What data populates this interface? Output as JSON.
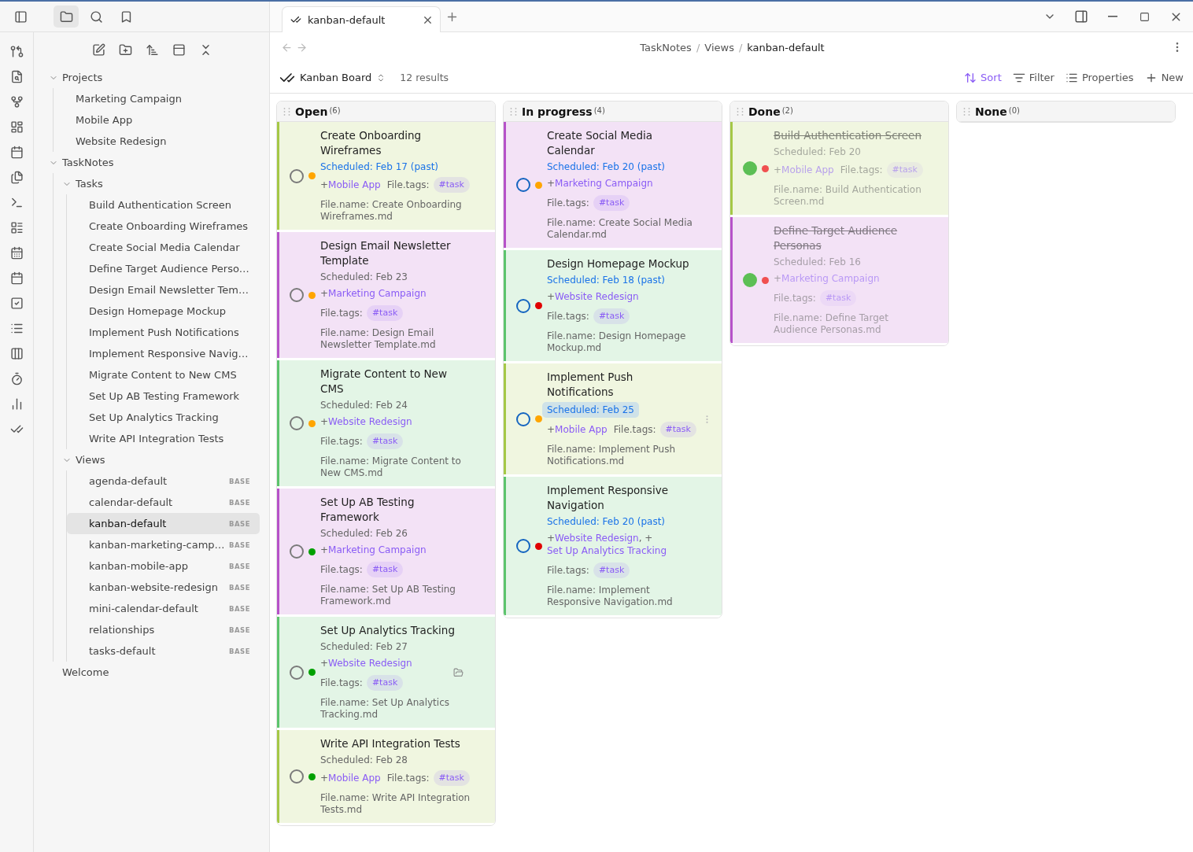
{
  "sidebar_tabs": [
    {
      "kind": "files",
      "selected": true
    },
    {
      "kind": "search",
      "selected": false
    },
    {
      "kind": "bookmarks",
      "selected": false
    }
  ],
  "file_tree": [
    {
      "label": "Projects",
      "kind": "folder",
      "expanded": true,
      "selected": false,
      "children": [
        {
          "label": "Marketing Campaign",
          "kind": "file",
          "selected": false
        },
        {
          "label": "Mobile App",
          "kind": "file",
          "selected": false
        },
        {
          "label": "Website Redesign",
          "kind": "file",
          "selected": false
        }
      ]
    },
    {
      "label": "TaskNotes",
      "kind": "folder",
      "expanded": true,
      "selected": false,
      "children": [
        {
          "label": "Tasks",
          "kind": "folder",
          "expanded": true,
          "selected": false,
          "children": [
            {
              "label": "Build Authentication Screen",
              "kind": "file",
              "selected": false
            },
            {
              "label": "Create Onboarding Wireframes",
              "kind": "file",
              "selected": false
            },
            {
              "label": "Create Social Media Calendar",
              "kind": "file",
              "selected": false
            },
            {
              "label": "Define Target Audience Perso…",
              "kind": "file",
              "selected": false
            },
            {
              "label": "Design Email Newsletter Tem…",
              "kind": "file",
              "selected": false
            },
            {
              "label": "Design Homepage Mockup",
              "kind": "file",
              "selected": false
            },
            {
              "label": "Implement Push Notifications",
              "kind": "file",
              "selected": false
            },
            {
              "label": "Implement Responsive Navig…",
              "kind": "file",
              "selected": false
            },
            {
              "label": "Migrate Content to New CMS",
              "kind": "file",
              "selected": false
            },
            {
              "label": "Set Up AB Testing Framework",
              "kind": "file",
              "selected": false
            },
            {
              "label": "Set Up Analytics Tracking",
              "kind": "file",
              "selected": false
            },
            {
              "label": "Write API Integration Tests",
              "kind": "file",
              "selected": false
            }
          ]
        },
        {
          "label": "Views",
          "kind": "folder",
          "expanded": true,
          "selected": false,
          "children": [
            {
              "label": "agenda-default",
              "kind": "file",
              "badge": "BASE",
              "selected": false
            },
            {
              "label": "calendar-default",
              "kind": "file",
              "badge": "BASE",
              "selected": false
            },
            {
              "label": "kanban-default",
              "kind": "file",
              "badge": "BASE",
              "selected": true
            },
            {
              "label": "kanban-marketing-camp…",
              "kind": "file",
              "badge": "BASE",
              "selected": false
            },
            {
              "label": "kanban-mobile-app",
              "kind": "file",
              "badge": "BASE",
              "selected": false
            },
            {
              "label": "kanban-website-redesign",
              "kind": "file",
              "badge": "BASE",
              "selected": false
            },
            {
              "label": "mini-calendar-default",
              "kind": "file",
              "badge": "BASE",
              "selected": false
            },
            {
              "label": "relationships",
              "kind": "file",
              "badge": "BASE",
              "selected": false
            },
            {
              "label": "tasks-default",
              "kind": "file",
              "badge": "BASE",
              "selected": false
            }
          ]
        }
      ]
    },
    {
      "label": "Welcome",
      "kind": "file",
      "selected": false
    }
  ],
  "tab": {
    "title": "kanban-default"
  },
  "breadcrumb": {
    "separator": "/",
    "parts": [
      "TaskNotes",
      "Views",
      "kanban-default"
    ]
  },
  "toolbar": {
    "view_name": "Kanban Board",
    "results": "12 results",
    "actions": [
      {
        "kind": "sort",
        "label": "Sort",
        "active": true
      },
      {
        "kind": "filter",
        "label": "Filter",
        "active": false
      },
      {
        "kind": "properties",
        "label": "Properties",
        "active": false
      },
      {
        "kind": "new",
        "label": "New",
        "active": false
      }
    ]
  },
  "columns": [
    {
      "title": "Open",
      "count": "(6)",
      "cards": [
        {
          "title": "Create Onboarding Wireframes",
          "kind": "open",
          "color": "#a5c846",
          "priority": {
            "color": "#ffa500"
          },
          "scheduled": {
            "text": "Scheduled: Feb 17 (past)",
            "past": true,
            "highlighted": false
          },
          "projects": [
            {
              "kind": "plain",
              "text": "+"
            },
            {
              "kind": "link",
              "text": "Mobile App"
            }
          ],
          "tags_label": "File.tags:",
          "tags": [
            "#task"
          ],
          "filename": "File.name: Create Onboarding Wireframes.md"
        },
        {
          "title": "Design Email Newsletter Template",
          "kind": "open",
          "color": "#b652c9",
          "priority": {
            "color": "#ffa500"
          },
          "scheduled": {
            "text": "Scheduled: Feb 23",
            "past": false,
            "highlighted": false
          },
          "projects": [
            {
              "kind": "plain",
              "text": "+"
            },
            {
              "kind": "link",
              "text": "Marketing Campaign"
            }
          ],
          "tags_label": "File.tags:",
          "tags": [
            "#task"
          ],
          "filename": "File.name: Design Email Newsletter Template.md"
        },
        {
          "title": "Migrate Content to New CMS",
          "kind": "open",
          "color": "#5cc46c",
          "priority": {
            "color": "#ffa500"
          },
          "scheduled": {
            "text": "Scheduled: Feb 24",
            "past": false,
            "highlighted": false
          },
          "projects": [
            {
              "kind": "plain",
              "text": "+"
            },
            {
              "kind": "link",
              "text": "Website Redesign"
            }
          ],
          "tags_label": "File.tags:",
          "tags": [
            "#task"
          ],
          "filename": "File.name: Migrate Content to New CMS.md"
        },
        {
          "title": "Set Up AB Testing Framework",
          "kind": "open",
          "color": "#b652c9",
          "priority": {
            "color": "#00a000"
          },
          "scheduled": {
            "text": "Scheduled: Feb 26",
            "past": false,
            "highlighted": false
          },
          "projects": [
            {
              "kind": "plain",
              "text": "+"
            },
            {
              "kind": "link",
              "text": "Marketing Campaign"
            }
          ],
          "tags_label": "File.tags:",
          "tags": [
            "#task"
          ],
          "filename": "File.name: Set Up AB Testing Framework.md"
        },
        {
          "title": "Set Up Analytics Tracking",
          "kind": "open",
          "color": "#5cc46c",
          "priority": {
            "color": "#00a000"
          },
          "scheduled": {
            "text": "Scheduled: Feb 27",
            "past": false,
            "highlighted": false
          },
          "projects": [
            {
              "kind": "plain",
              "text": "+"
            },
            {
              "kind": "link",
              "text": "Website Redesign"
            }
          ],
          "folder_icon": true,
          "tags_label": "File.tags:",
          "tags": [
            "#task"
          ],
          "filename": "File.name: Set Up Analytics Tracking.md"
        },
        {
          "title": "Write API Integration Tests",
          "kind": "open",
          "color": "#a5c846",
          "priority": {
            "color": "#00a000"
          },
          "scheduled": {
            "text": "Scheduled: Feb 28",
            "past": false,
            "highlighted": false
          },
          "projects": [
            {
              "kind": "plain",
              "text": "+"
            },
            {
              "kind": "link",
              "text": "Mobile App"
            }
          ],
          "tags_label": "File.tags:",
          "tags": [
            "#task"
          ],
          "filename": "File.name: Write API Integration Tests.md"
        }
      ]
    },
    {
      "title": "In progress",
      "count": "(4)",
      "cards": [
        {
          "title": "Create Social Media Calendar",
          "kind": "in-progress",
          "color": "#b652c9",
          "priority": {
            "color": "#ffa500"
          },
          "scheduled": {
            "text": "Scheduled: Feb 20 (past)",
            "past": true,
            "highlighted": false
          },
          "projects": [
            {
              "kind": "plain",
              "text": "+"
            },
            {
              "kind": "link",
              "text": "Marketing Campaign"
            }
          ],
          "tags_label": "File.tags:",
          "tags": [
            "#task"
          ],
          "filename": "File.name: Create Social Media Calendar.md"
        },
        {
          "title": "Design Homepage Mockup",
          "kind": "in-progress",
          "color": "#5cc46c",
          "priority": {
            "color": "#e00000"
          },
          "scheduled": {
            "text": "Scheduled: Feb 18 (past)",
            "past": true,
            "highlighted": false
          },
          "projects": [
            {
              "kind": "plain",
              "text": "+"
            },
            {
              "kind": "link",
              "text": "Website Redesign"
            }
          ],
          "tags_label": "File.tags:",
          "tags": [
            "#task"
          ],
          "filename": "File.name: Design Homepage Mockup.md"
        },
        {
          "title": "Implement Push Notifications",
          "kind": "in-progress",
          "color": "#a5c846",
          "priority": {
            "color": "#ffa500"
          },
          "scheduled": {
            "text": "Scheduled: Feb 25",
            "past": false,
            "highlighted": true
          },
          "projects": [
            {
              "kind": "plain",
              "text": "+"
            },
            {
              "kind": "link",
              "text": "Mobile App"
            }
          ],
          "menu_handle": true,
          "tags_label": "File.tags:",
          "tags": [
            "#task"
          ],
          "filename": "File.name: Implement Push Notifications.md"
        },
        {
          "title": "Implement Responsive Navigation",
          "kind": "in-progress",
          "color": "#5cc46c",
          "priority": {
            "color": "#e00000"
          },
          "scheduled": {
            "text": "Scheduled: Feb 20 (past)",
            "past": true,
            "highlighted": false
          },
          "projects": [
            {
              "kind": "plain",
              "text": "+"
            },
            {
              "kind": "link",
              "text": "Website Redesign"
            },
            {
              "kind": "plain",
              "text": ", +"
            },
            {
              "kind": "link",
              "text": "Set Up Analytics Tracking"
            }
          ],
          "tags_label": "File.tags:",
          "tags": [
            "#task"
          ],
          "filename": "File.name: Implement Responsive Navigation.md"
        }
      ]
    },
    {
      "title": "Done",
      "count": "(2)",
      "cards": [
        {
          "title": "Build Authentication Screen",
          "kind": "done",
          "color": "#a5c846",
          "priority": {
            "color": "#f05050"
          },
          "scheduled": {
            "text": "Scheduled: Feb 20",
            "past": false,
            "highlighted": false
          },
          "projects": [
            {
              "kind": "plain",
              "text": "+"
            },
            {
              "kind": "link",
              "text": "Mobile App"
            }
          ],
          "tags_label": "File.tags:",
          "tags": [
            "#task"
          ],
          "filename": "File.name: Build Authentication Screen.md"
        },
        {
          "title": "Define Target Audience Personas",
          "kind": "done",
          "color": "#b652c9",
          "priority": {
            "color": "#f05050"
          },
          "scheduled": {
            "text": "Scheduled: Feb 16",
            "past": false,
            "highlighted": false
          },
          "projects": [
            {
              "kind": "plain",
              "text": "+"
            },
            {
              "kind": "link",
              "text": "Marketing Campaign"
            }
          ],
          "tags_label": "File.tags:",
          "tags": [
            "#task"
          ],
          "filename": "File.name: Define Target Audience Personas.md"
        }
      ]
    },
    {
      "title": "None",
      "count": "(0)"
    }
  ]
}
